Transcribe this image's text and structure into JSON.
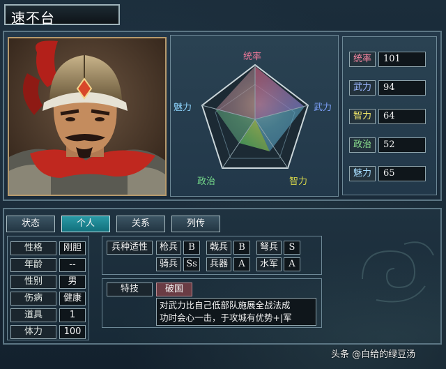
{
  "general_name": "速不台",
  "radar": {
    "labels": {
      "top": "统率",
      "right": "武力",
      "bottom_right": "智力",
      "bottom_left": "政治",
      "left": "魅力"
    },
    "label_colors": {
      "top": "#f07a9a",
      "right": "#7fa4ff",
      "bottom_right": "#d6d64a",
      "bottom_left": "#74d98a",
      "left": "#8fd6ff"
    }
  },
  "stats": [
    {
      "label": "统率",
      "value": "101",
      "color": "#ff8aa5"
    },
    {
      "label": "武力",
      "value": "94",
      "color": "#9bb6ff"
    },
    {
      "label": "智力",
      "value": "64",
      "color": "#f4e96a"
    },
    {
      "label": "政治",
      "value": "52",
      "color": "#8be08e"
    },
    {
      "label": "魅力",
      "value": "65",
      "color": "#a8deff"
    }
  ],
  "tabs": [
    {
      "label": "状态",
      "active": false
    },
    {
      "label": "个人",
      "active": true
    },
    {
      "label": "关系",
      "active": false
    },
    {
      "label": "列传",
      "active": false
    }
  ],
  "personal": [
    {
      "label": "性格",
      "value": "刚胆"
    },
    {
      "label": "年龄",
      "value": "--"
    },
    {
      "label": "性别",
      "value": "男"
    },
    {
      "label": "伤病",
      "value": "健康"
    },
    {
      "label": "道具",
      "value": "1"
    },
    {
      "label": "体力",
      "value": "100"
    }
  ],
  "aptitude": {
    "title": "兵种适性",
    "row1": [
      {
        "label": "枪兵",
        "grade": "B"
      },
      {
        "label": "戟兵",
        "grade": "B"
      },
      {
        "label": "弩兵",
        "grade": "S"
      }
    ],
    "row2": [
      {
        "label": "骑兵",
        "grade": "Ss"
      },
      {
        "label": "兵器",
        "grade": "A"
      },
      {
        "label": "水军",
        "grade": "A"
      }
    ]
  },
  "skill": {
    "title": "特技",
    "name": "破国",
    "description": "对武力比自己低部队施展全战法成\n功时会心一击，于攻城有优势+|军"
  },
  "watermark": "头条 @白给的绿豆汤"
}
